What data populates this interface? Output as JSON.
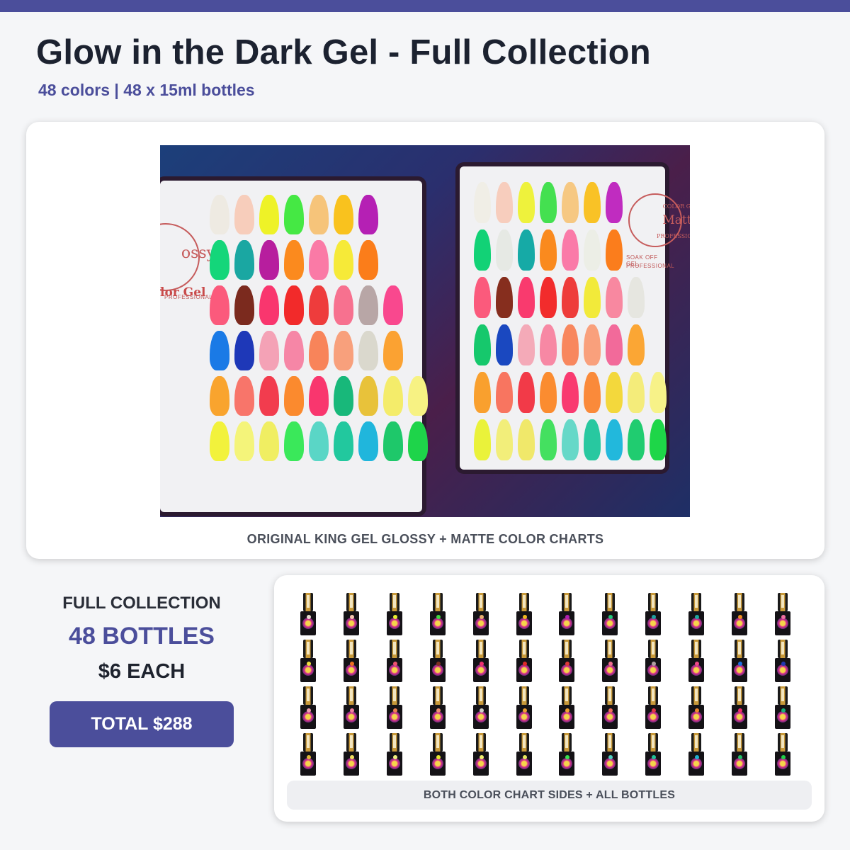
{
  "header": {
    "title": "Glow in the Dark Gel - Full Collection",
    "subtitle": "48 colors | 48 x 15ml bottles"
  },
  "photo": {
    "caption": "ORIGINAL KING GEL GLOSSY + MATTE COLOR CHARTS",
    "left_chart": {
      "brand_word": "ossy",
      "side_word": "lor Gel",
      "ring_text": "PROFESSIONAL"
    },
    "right_chart": {
      "brand_word": "Matte",
      "ring_top": "COLOR GEL",
      "ring_bottom": "PROFESSIONAL",
      "line1": "SOAK OFF GEL",
      "line2": "PROFESSIONAL"
    },
    "left_colors": [
      [
        "#eeeae2",
        "#f7cdbb",
        "#eef227",
        "#45e844",
        "#f6c47a",
        "#f9c21e",
        "#b520b4"
      ],
      [
        "#14d67a",
        "#1aa7a2",
        "#b71e9e",
        "#fb8a1e",
        "#fa7aa6",
        "#f6ea38",
        "#fb7d1a"
      ],
      [
        "#fb5a7c",
        "#7b2a1e",
        "#f9366e",
        "#f22a2a",
        "#ee3c3c",
        "#f7718f",
        "#b8a6a6",
        "#f9488e"
      ],
      [
        "#1a7ae6",
        "#1e38b8",
        "#f4a2b6",
        "#f686a6",
        "#f8845a",
        "#f8a07c",
        "#dad8cd",
        "#fba232"
      ],
      [
        "#f9a42e",
        "#f8756a",
        "#f23c4e",
        "#fb8a2e",
        "#f9366e",
        "#18b87a",
        "#e8c23a",
        "#f4ec6a",
        "#f7f283"
      ],
      [
        "#f2f23c",
        "#f4f47a",
        "#f0ee62",
        "#3ae85a",
        "#5ad6c6",
        "#22c89e",
        "#20b6dc",
        "#1ec86a",
        "#1ed44a"
      ]
    ],
    "right_colors": [
      [
        "#f0eee6",
        "#f7cdbd",
        "#eef23c",
        "#44e050",
        "#f6c882",
        "#f9c226",
        "#c02cc0"
      ],
      [
        "#12d276",
        "#e6e9e4",
        "#16aaa6",
        "#fa8a1e",
        "#fa7aa8",
        "#eceee6",
        "#fb7d1c"
      ],
      [
        "#fb5a7c",
        "#862e1e",
        "#f93a6e",
        "#f22c2c",
        "#ee3c3a",
        "#f2ea3a",
        "#f888a0",
        "#e6e6e0"
      ],
      [
        "#16c86c",
        "#1a48c0",
        "#f4aab8",
        "#f788a4",
        "#f8875e",
        "#f9a07c",
        "#f26a9a",
        "#fba634"
      ],
      [
        "#f9a02e",
        "#f87560",
        "#f23a48",
        "#fb8c30",
        "#f93a70",
        "#fa8a3a",
        "#f3d83c",
        "#f4ec7a",
        "#f7f288"
      ],
      [
        "#eaf23a",
        "#f2ee7a",
        "#f0e86a",
        "#44e060",
        "#66d8c8",
        "#28c8a0",
        "#22b8dc",
        "#20cc70",
        "#1ed648"
      ]
    ]
  },
  "summary": {
    "label": "FULL COLLECTION",
    "count": "48 BOTTLES",
    "price": "$6 EACH",
    "total_button": "TOTAL $288"
  },
  "bottles": {
    "caption": "BOTH COLOR CHART SIDES + ALL BOTTLES",
    "count": 48,
    "dot_colors": [
      "#e8e0d0",
      "#f4c8b0",
      "#e8ee30",
      "#40d840",
      "#e8b070",
      "#f0b820",
      "#b020b0",
      "#20c878",
      "#20a0a0",
      "#20a8a0",
      "#f09020",
      "#f070a0",
      "#f0e040",
      "#f07020",
      "#f05070",
      "#803020",
      "#f03070",
      "#e02828",
      "#e03838",
      "#f07090",
      "#b0a0a0",
      "#f04888",
      "#2070e0",
      "#2038b0",
      "#f0a0b0",
      "#f080a0",
      "#f08050",
      "#f09070",
      "#d0d0c8",
      "#f0a030",
      "#f0a030",
      "#f07060",
      "#e03848",
      "#f08830",
      "#f03070",
      "#18b078",
      "#e0b838",
      "#f0e060",
      "#f0f080",
      "#e8e830",
      "#f0f070",
      "#e8e860",
      "#38e050",
      "#50d0c0",
      "#20c098",
      "#20b0d0",
      "#20c068",
      "#20d048"
    ]
  }
}
